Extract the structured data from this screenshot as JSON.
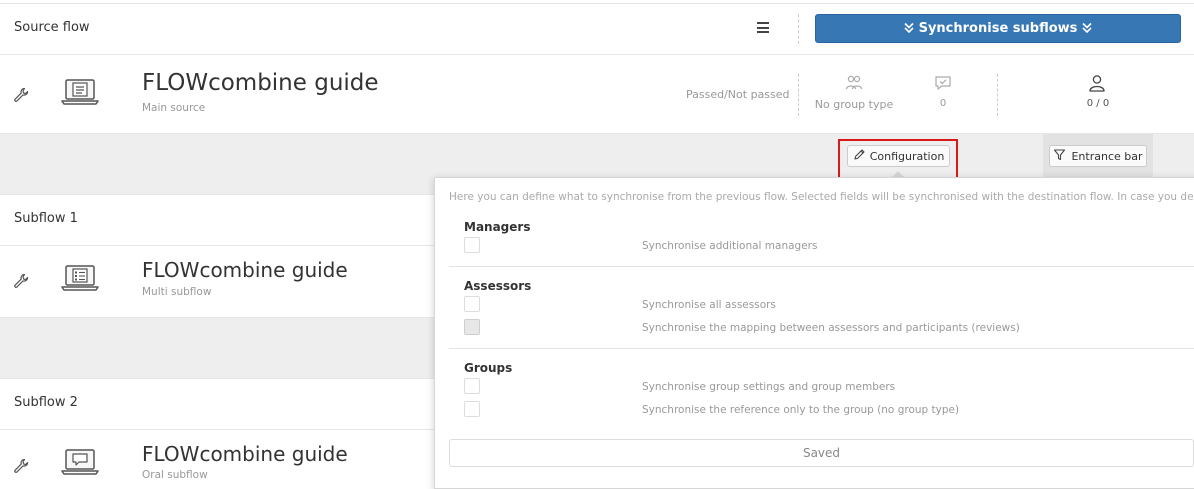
{
  "source_flow": {
    "header_label": "Source flow",
    "sync_button_label": "Synchronise subflows",
    "title": "FLOWcombine guide",
    "subtitle": "Main source",
    "result_type": "Passed/Not passed",
    "group_type": "No group type",
    "messages_count": "0",
    "participants_count": "0 / 0"
  },
  "toolbar": {
    "configuration_label": "Configuration",
    "entrance_bar_label": "Entrance bar"
  },
  "subflows": [
    {
      "header_label": "Subflow 1",
      "title": "FLOWcombine guide",
      "subtitle": "Multi subflow"
    },
    {
      "header_label": "Subflow 2",
      "title": "FLOWcombine guide",
      "subtitle": "Oral subflow"
    }
  ],
  "config_panel": {
    "intro": "Here you can define what to synchronise from the previous flow. Selected fields will be synchronised with the destination flow. In case you deselect",
    "sections": [
      {
        "title": "Managers",
        "options": [
          {
            "label": "Synchronise additional managers",
            "checked": false,
            "disabled": false
          }
        ]
      },
      {
        "title": "Assessors",
        "options": [
          {
            "label": "Synchronise all assessors",
            "checked": false,
            "disabled": false
          },
          {
            "label": "Synchronise the mapping between assessors and participants (reviews)",
            "checked": false,
            "disabled": true
          }
        ]
      },
      {
        "title": "Groups",
        "options": [
          {
            "label": "Synchronise group settings and group members",
            "checked": false,
            "disabled": false
          },
          {
            "label": "Synchronise the reference only to the group (no group type)",
            "checked": false,
            "disabled": false
          }
        ]
      }
    ],
    "saved_label": "Saved"
  },
  "colors": {
    "primary": "#3777b3",
    "highlight": "#d91a1a",
    "band": "#eeeeee"
  },
  "icons": [
    "menu-icon",
    "chevron-double-down-icon",
    "wrench-icon",
    "laptop-document-icon",
    "laptop-list-icon",
    "laptop-chat-icon",
    "group-icon",
    "chat-check-icon",
    "user-icon",
    "pencil-icon",
    "filter-icon"
  ]
}
